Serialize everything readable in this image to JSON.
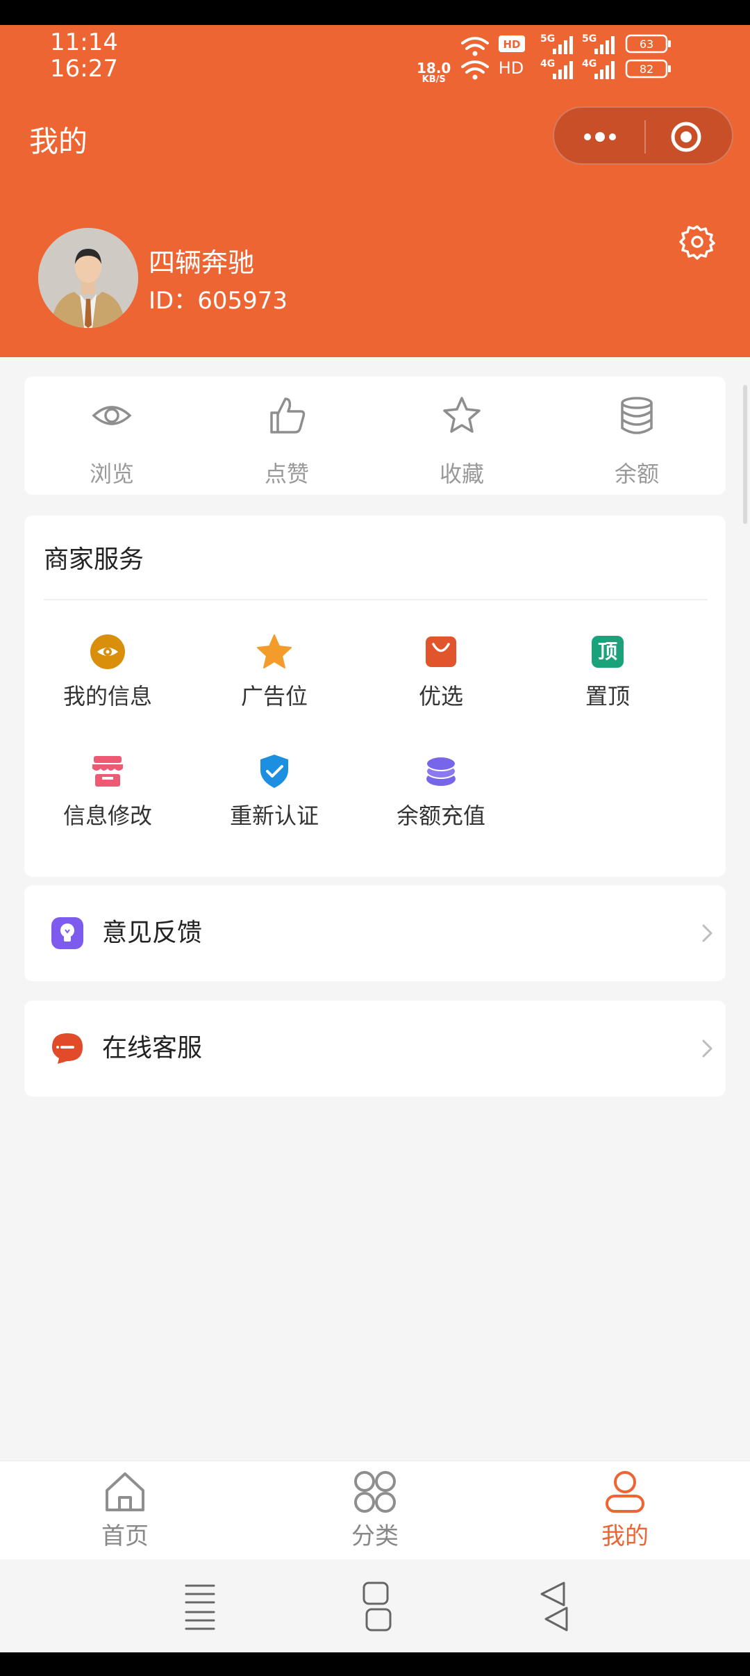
{
  "status_bar": {
    "time_top": "11:14",
    "time_bottom": "16:27",
    "net_speed": "18.0",
    "net_speed_unit": "KB/S",
    "hd_label": "HD",
    "sig_5g": "5G",
    "sig_4g": "4G",
    "battery_top": "63",
    "battery_bottom": "82"
  },
  "header": {
    "title": "我的",
    "color": "#EE6534"
  },
  "profile": {
    "name": "四辆奔驰",
    "id_text": "ID：605973"
  },
  "stats": [
    {
      "label": "浏览",
      "icon": "eye-icon"
    },
    {
      "label": "点赞",
      "icon": "thumbs-up-icon"
    },
    {
      "label": "收藏",
      "icon": "star-icon"
    },
    {
      "label": "余额",
      "icon": "database-icon"
    }
  ],
  "services": {
    "title": "商家服务",
    "items": [
      {
        "label": "我的信息",
        "icon": "eye-icon",
        "color": "#D98E0C"
      },
      {
        "label": "广告位",
        "icon": "star-icon",
        "color": "#F39C2B"
      },
      {
        "label": "优选",
        "icon": "shopping-bag-icon",
        "color": "#E0552B"
      },
      {
        "label": "置顶",
        "icon": "top-icon",
        "glyph": "顶",
        "color": "#1AA37A"
      },
      {
        "label": "信息修改",
        "icon": "store-icon",
        "color": "#EE5A74"
      },
      {
        "label": "重新认证",
        "icon": "shield-check-icon",
        "color": "#1C8FE0"
      },
      {
        "label": "余额充值",
        "icon": "coins-icon",
        "color": "#7866E8"
      }
    ]
  },
  "rows": [
    {
      "label": "意见反馈",
      "icon": "bulb-icon",
      "color": "#7E5BEF"
    },
    {
      "label": "在线客服",
      "icon": "chat-icon",
      "color": "#E24B2A"
    }
  ],
  "tabbar": {
    "items": [
      {
        "label": "首页",
        "icon": "home-icon",
        "active": false
      },
      {
        "label": "分类",
        "icon": "category-icon",
        "active": false
      },
      {
        "label": "我的",
        "icon": "user-icon",
        "active": true
      }
    ],
    "active_color": "#EE6534"
  }
}
